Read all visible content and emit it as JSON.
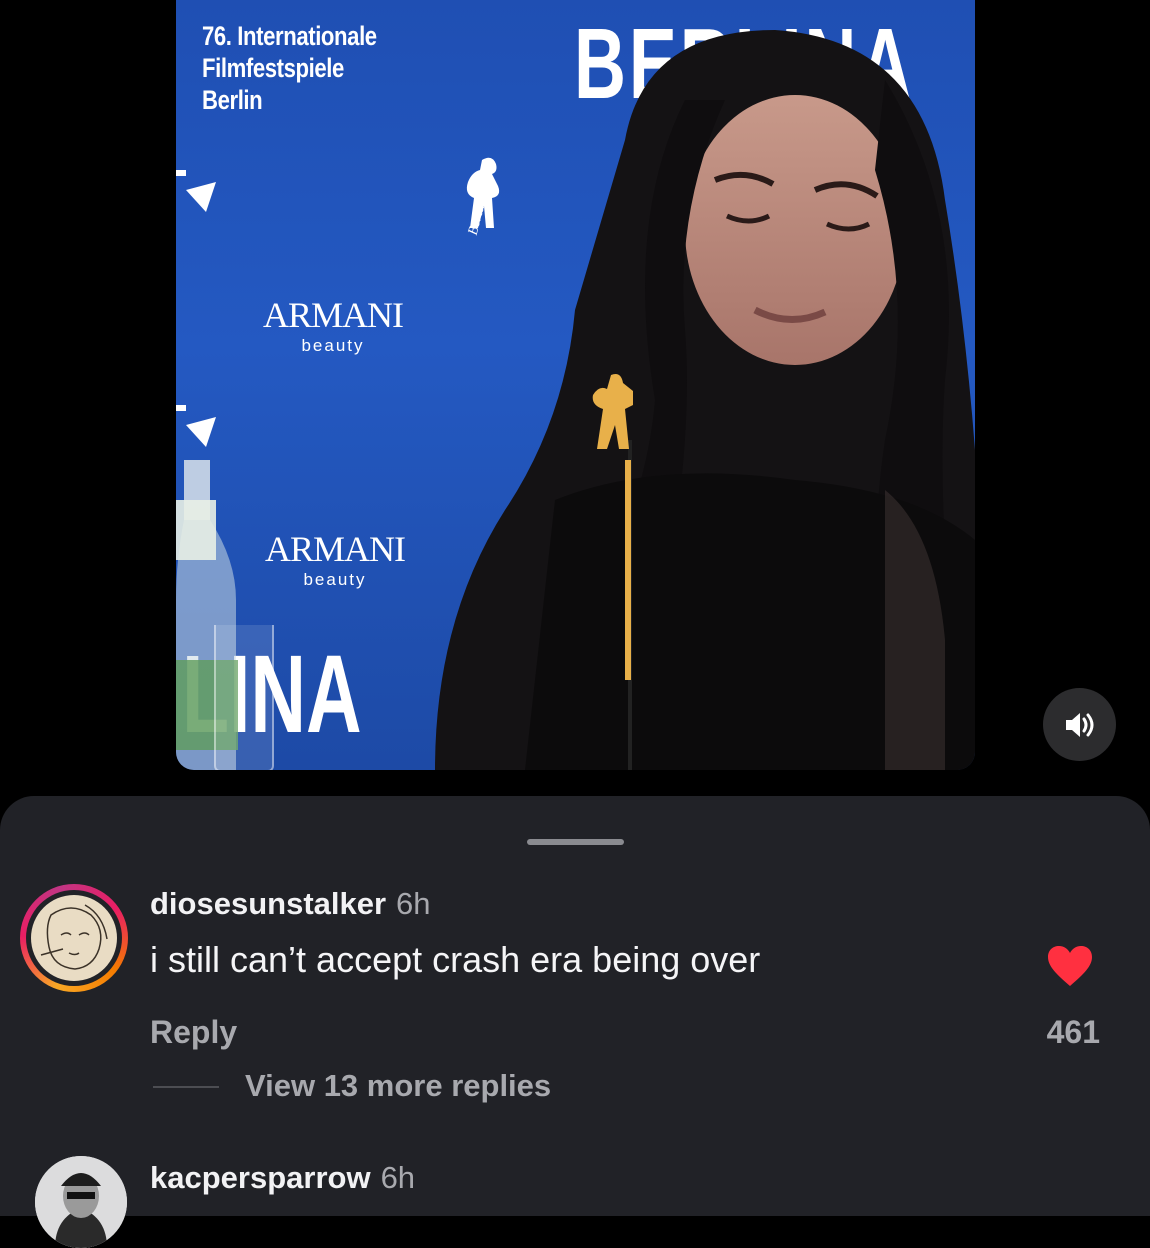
{
  "video": {
    "festival_title": "76. Internationale\nFilmfestspiele\nBerlin",
    "backdrop_top_text": "BERLINA",
    "backdrop_bottom_text": "LINA",
    "sponsor_1": {
      "brand": "ARMANI",
      "sub": "beauty"
    },
    "sponsor_2": {
      "brand": "ARMANI",
      "sub": "beauty"
    },
    "backdrop_color": "#2459c2"
  },
  "volume_icon": "speaker-on-icon",
  "comments": [
    {
      "username": "diosesunstalker",
      "time": "6h",
      "text": "i still can’t accept crash era being over",
      "reply_label": "Reply",
      "likes": "461",
      "liked": true,
      "heart_color": "#ff3040",
      "view_more": "View 13 more replies"
    },
    {
      "username": "kacpersparrow",
      "time": "6h"
    }
  ]
}
